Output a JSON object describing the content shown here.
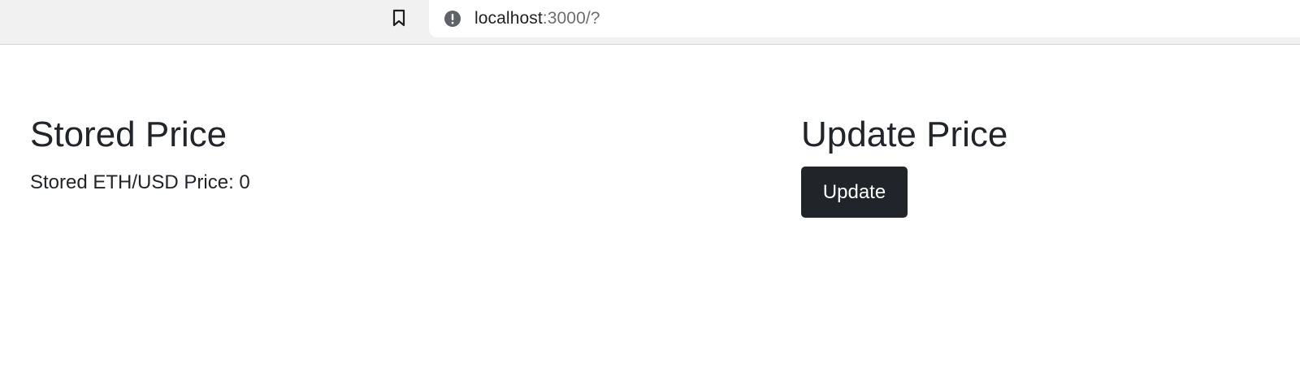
{
  "browser": {
    "url_host": "localhost",
    "url_rest": ":3000/?",
    "bookmark_icon": "bookmark-icon",
    "site_info_icon": "info-icon"
  },
  "stored_price": {
    "heading": "Stored Price",
    "label": "Stored ETH/USD Price: 0"
  },
  "update_price": {
    "heading": "Update Price",
    "button_label": "Update",
    "button_color": "#212529"
  }
}
